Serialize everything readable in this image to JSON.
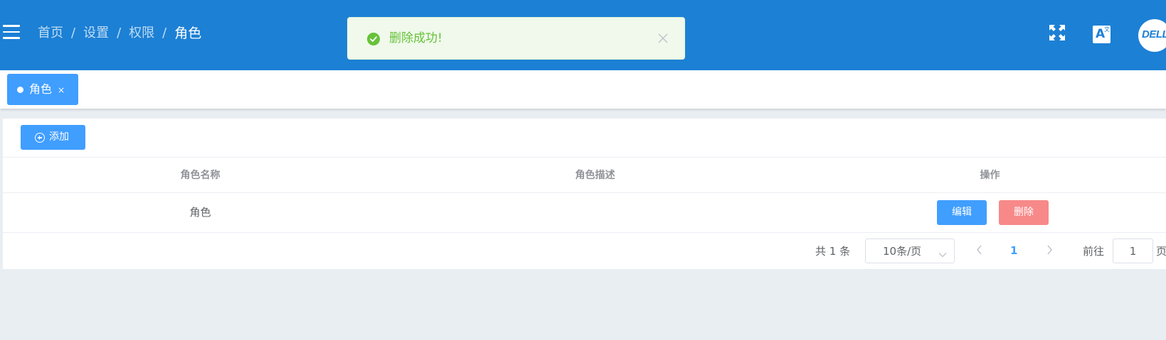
{
  "header": {
    "breadcrumb": [
      "首页",
      "设置",
      "权限",
      "角色"
    ],
    "separator": "/",
    "avatar_logo_text": "DELL",
    "language_icon_letter": "A",
    "language_icon_sub": "文"
  },
  "toast": {
    "message": "删除成功!",
    "type": "success"
  },
  "tags": [
    {
      "label": "角色",
      "close": "×"
    }
  ],
  "toolbar": {
    "add_label": "添加"
  },
  "table": {
    "columns": [
      "角色名称",
      "角色描述",
      "操作"
    ],
    "rows": [
      {
        "name": "角色",
        "description": "",
        "edit_label": "编辑",
        "delete_label": "删除"
      }
    ]
  },
  "pagination": {
    "total_text": "共 1 条",
    "page_size": "10条/页",
    "current_page": "1",
    "goto_label": "前往",
    "goto_value": "1",
    "page_suffix": "页"
  },
  "colors": {
    "header_bg": "#1c80d5",
    "primary": "#409eff",
    "danger": "#f78989",
    "success": "#67c23a",
    "page_bg": "#e9eef3"
  }
}
